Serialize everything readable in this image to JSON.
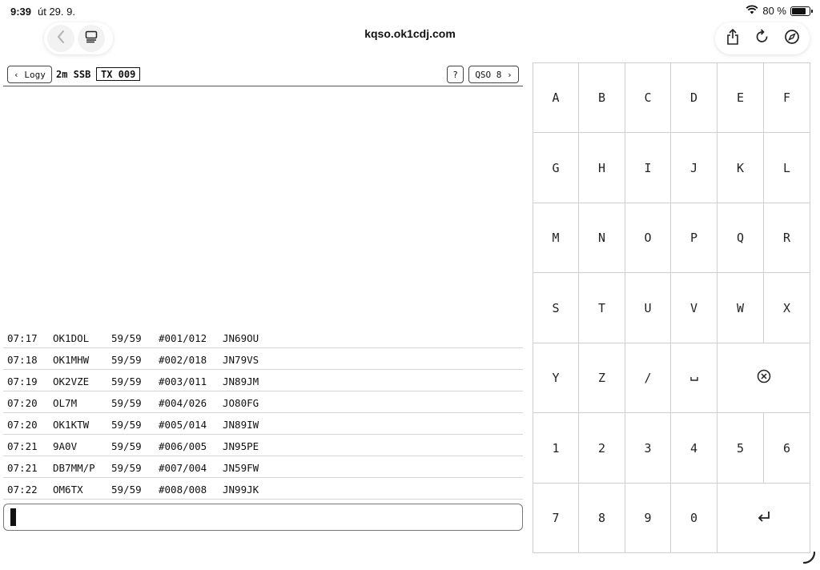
{
  "status_bar": {
    "time": "9:39",
    "date": "út 29. 9.",
    "battery_percent": "80 %",
    "battery_level": 0.8
  },
  "browser": {
    "url": "kqso.ok1cdj.com",
    "icons": [
      "back-icon",
      "tabs-icon",
      "share-icon",
      "reload-icon",
      "compass-icon"
    ]
  },
  "header": {
    "back_label": "‹ Logy",
    "band_mode": "2m SSB",
    "tx_label": "TX 009",
    "help_label": "?",
    "qso_label": "QSO 8 ›"
  },
  "log": {
    "rows": [
      {
        "time": "07:17",
        "call": "OK1DOL",
        "rst": "59/59",
        "nr": "#001/012",
        "locator": "JN69OU"
      },
      {
        "time": "07:18",
        "call": "OK1MHW",
        "rst": "59/59",
        "nr": "#002/018",
        "locator": "JN79VS"
      },
      {
        "time": "07:19",
        "call": "OK2VZE",
        "rst": "59/59",
        "nr": "#003/011",
        "locator": "JN89JM"
      },
      {
        "time": "07:20",
        "call": "OL7M",
        "rst": "59/59",
        "nr": "#004/026",
        "locator": "JO80FG"
      },
      {
        "time": "07:20",
        "call": "OK1KTW",
        "rst": "59/59",
        "nr": "#005/014",
        "locator": "JN89IW"
      },
      {
        "time": "07:21",
        "call": "9A0V",
        "rst": "59/59",
        "nr": "#006/005",
        "locator": "JN95PE"
      },
      {
        "time": "07:21",
        "call": "DB7MM/P",
        "rst": "59/59",
        "nr": "#007/004",
        "locator": "JN59FW"
      },
      {
        "time": "07:22",
        "call": "OM6TX",
        "rst": "59/59",
        "nr": "#008/008",
        "locator": "JN99JK"
      }
    ]
  },
  "entry": {
    "value": ""
  },
  "keypad": {
    "rows": [
      [
        "A",
        "B",
        "C",
        "D",
        "E",
        "F"
      ],
      [
        "G",
        "H",
        "I",
        "J",
        "K",
        "L"
      ],
      [
        "M",
        "N",
        "O",
        "P",
        "Q",
        "R"
      ],
      [
        "S",
        "T",
        "U",
        "V",
        "W",
        "X"
      ],
      [
        "Y",
        "Z",
        "/",
        "␣",
        "⌫"
      ],
      [
        "1",
        "2",
        "3",
        "4",
        "5",
        "6"
      ],
      [
        "7",
        "8",
        "9",
        "0",
        "↵"
      ]
    ]
  }
}
